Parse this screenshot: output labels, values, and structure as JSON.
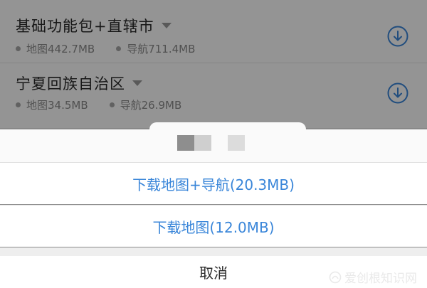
{
  "list": {
    "items": [
      {
        "title": "基础功能包+直辖市",
        "map_size": "地图442.7MB",
        "nav_size": "导航711.4MB"
      },
      {
        "title": "宁夏回族自治区",
        "map_size": "地图34.5MB",
        "nav_size": "导航26.9MB"
      }
    ]
  },
  "sheet": {
    "options": [
      {
        "label": "下载地图+导航(20.3MB)"
      },
      {
        "label": "下载地图(12.0MB)"
      }
    ],
    "cancel_label": "取消"
  },
  "watermark": {
    "text": "爱创根知识网"
  },
  "colors": {
    "accent": "#3a86d9",
    "overlay": "rgba(0,0,0,0.42)"
  }
}
